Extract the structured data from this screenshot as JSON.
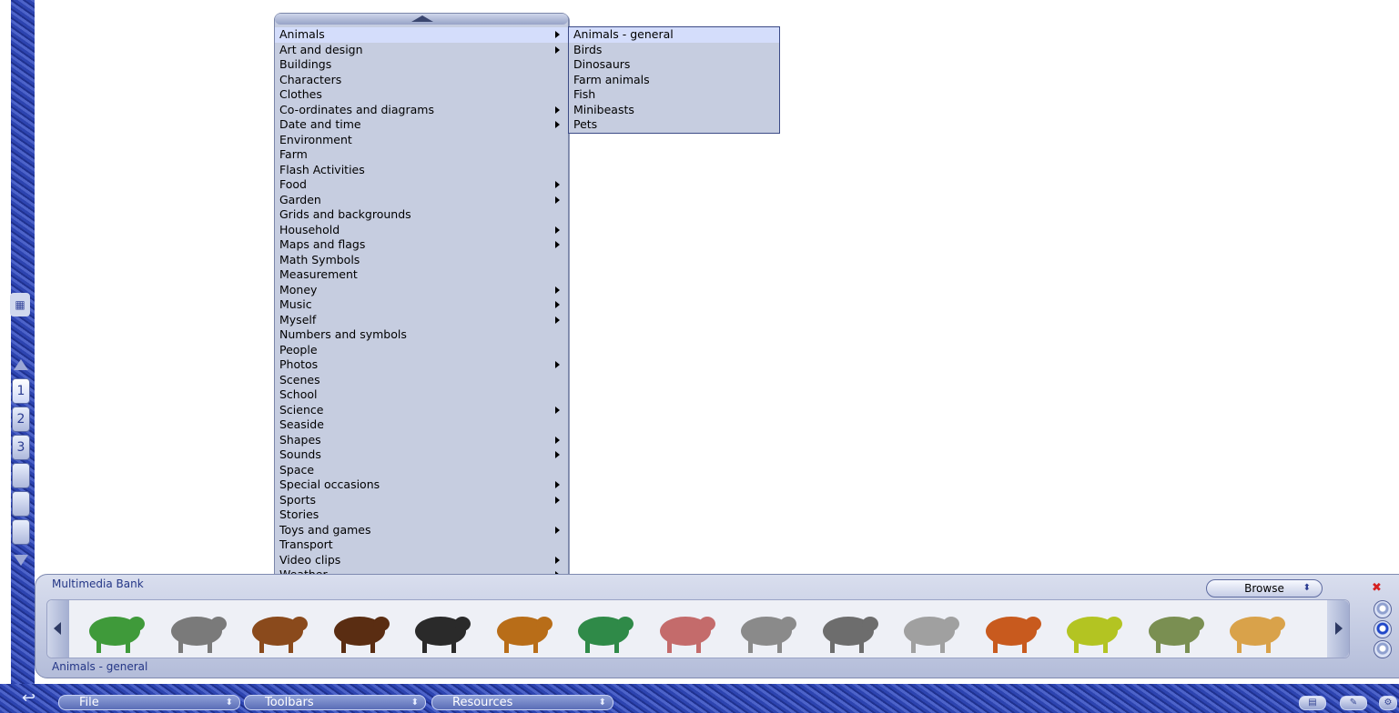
{
  "left_strip": {
    "grid_icon": "grid-view-icon",
    "pages": [
      "1",
      "2",
      "3",
      "",
      "",
      ""
    ]
  },
  "menu": {
    "items": [
      {
        "label": "Animals",
        "submenu": true
      },
      {
        "label": "Art and design",
        "submenu": true
      },
      {
        "label": "Buildings",
        "submenu": false
      },
      {
        "label": "Characters",
        "submenu": false
      },
      {
        "label": "Clothes",
        "submenu": false
      },
      {
        "label": "Co-ordinates and diagrams",
        "submenu": true
      },
      {
        "label": "Date and time",
        "submenu": true
      },
      {
        "label": "Environment",
        "submenu": false
      },
      {
        "label": "Farm",
        "submenu": false
      },
      {
        "label": "Flash Activities",
        "submenu": false
      },
      {
        "label": "Food",
        "submenu": true
      },
      {
        "label": "Garden",
        "submenu": true
      },
      {
        "label": "Grids and backgrounds",
        "submenu": false
      },
      {
        "label": "Household",
        "submenu": true
      },
      {
        "label": "Maps and flags",
        "submenu": true
      },
      {
        "label": "Math Symbols",
        "submenu": false
      },
      {
        "label": "Measurement",
        "submenu": false
      },
      {
        "label": "Money",
        "submenu": true
      },
      {
        "label": "Music",
        "submenu": true
      },
      {
        "label": "Myself",
        "submenu": true
      },
      {
        "label": "Numbers and symbols",
        "submenu": false
      },
      {
        "label": "People",
        "submenu": false
      },
      {
        "label": "Photos",
        "submenu": true
      },
      {
        "label": "Scenes",
        "submenu": false
      },
      {
        "label": "School",
        "submenu": false
      },
      {
        "label": "Science",
        "submenu": true
      },
      {
        "label": "Seaside",
        "submenu": false
      },
      {
        "label": "Shapes",
        "submenu": true
      },
      {
        "label": "Sounds",
        "submenu": true
      },
      {
        "label": "Space",
        "submenu": false
      },
      {
        "label": "Special occasions",
        "submenu": true
      },
      {
        "label": "Sports",
        "submenu": true
      },
      {
        "label": "Stories",
        "submenu": false
      },
      {
        "label": "Toys and games",
        "submenu": true
      },
      {
        "label": "Transport",
        "submenu": false
      },
      {
        "label": "Video clips",
        "submenu": true
      },
      {
        "label": "Weather",
        "submenu": true
      }
    ],
    "active_index": 0
  },
  "submenu": {
    "items": [
      "Animals - general",
      "Birds",
      "Dinosaurs",
      "Farm animals",
      "Fish",
      "Minibeasts",
      "Pets"
    ],
    "active_index": 0
  },
  "multimedia_bank": {
    "title": "Multimedia Bank",
    "browse_label": "Browse",
    "status": "Animals - general",
    "clips": [
      {
        "name": "crocodile-clip",
        "color": "#3f9a3a"
      },
      {
        "name": "bat-clip",
        "color": "#7a7a7a"
      },
      {
        "name": "brown-bear-clip",
        "color": "#8a4a1c"
      },
      {
        "name": "grizzly-bear-clip",
        "color": "#5a2d12"
      },
      {
        "name": "black-bear-clip",
        "color": "#2a2a2a"
      },
      {
        "name": "camel-clip",
        "color": "#b86d18"
      },
      {
        "name": "lizard-clip",
        "color": "#2f8a48"
      },
      {
        "name": "deer-clip",
        "color": "#c46b6b"
      },
      {
        "name": "elephant-clip-1",
        "color": "#8a8a8a"
      },
      {
        "name": "elephant-clip-2",
        "color": "#6d6d6d"
      },
      {
        "name": "elephant-clip-3",
        "color": "#a0a0a0"
      },
      {
        "name": "fox-clip",
        "color": "#c85a1e"
      },
      {
        "name": "frog-clip",
        "color": "#b3c422"
      },
      {
        "name": "toad-clip",
        "color": "#7a8f52"
      },
      {
        "name": "giraffe-clip",
        "color": "#d9a24a"
      }
    ],
    "close_icon": "close-icon"
  },
  "bottom_bar": {
    "file_label": "File",
    "toolbars_label": "Toolbars",
    "resources_label": "Resources"
  }
}
